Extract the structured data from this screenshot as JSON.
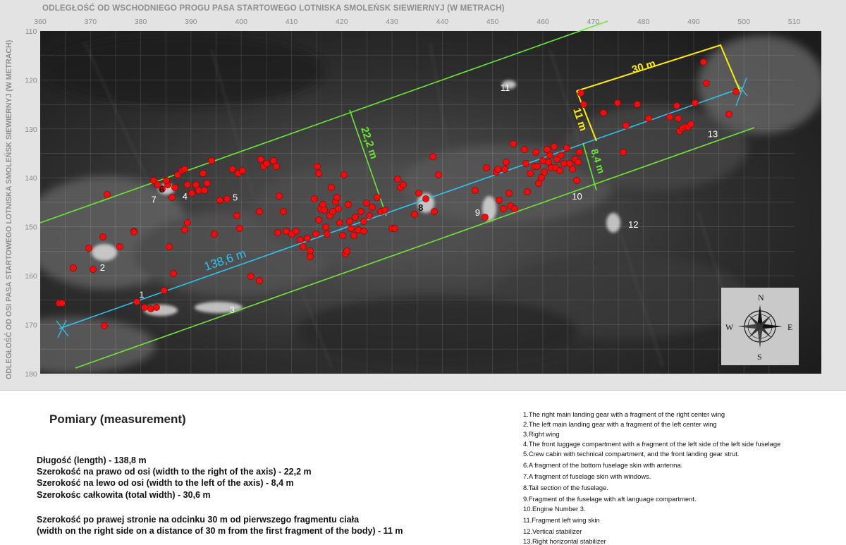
{
  "top_axis_title": "ODLEGŁOŚĆ OD WSCHODNIEGO PROGU PASA STARTOWEGO LOTNISKA SMOLEŃSK SIEWIERNYJ (W METRACH)",
  "left_axis_title": "ODLEGŁOŚĆ OD OSI PASA STARTOWEGO LOTNISKA SMOLEŃSK SIEWIERNYJ (W METRACH)",
  "x_ticks": [
    "360",
    "370",
    "380",
    "390",
    "400",
    "410",
    "420",
    "430",
    "440",
    "450",
    "460",
    "470",
    "480",
    "490",
    "500",
    "510"
  ],
  "y_ticks": [
    "110",
    "120",
    "130",
    "140",
    "150",
    "160",
    "170",
    "180"
  ],
  "x_range": [
    360,
    510
  ],
  "y_range": [
    110,
    180
  ],
  "dimension_labels": {
    "length": "138,6 m",
    "right_width": "22,2 m",
    "left_width": "8,4 m",
    "partial_width": "11 m",
    "section_length": "30 m"
  },
  "compass": {
    "n": "N",
    "s": "S",
    "e": "E",
    "w": "W"
  },
  "marker_labels": [
    {
      "text": "1",
      "x": 380.2,
      "y": 163.8
    },
    {
      "text": "2",
      "x": 372.4,
      "y": 158.3
    },
    {
      "text": "3",
      "x": 398.2,
      "y": 166.9
    },
    {
      "text": "4",
      "x": 388.8,
      "y": 143.7
    },
    {
      "text": "5",
      "x": 398.8,
      "y": 143.9
    },
    {
      "text": "6",
      "x": 384.2,
      "y": 142.3
    },
    {
      "text": "7",
      "x": 382.6,
      "y": 144.4
    },
    {
      "text": "8",
      "x": 435.7,
      "y": 146.0
    },
    {
      "text": "9",
      "x": 447.0,
      "y": 147.0
    },
    {
      "text": "10",
      "x": 466.8,
      "y": 143.7
    },
    {
      "text": "11",
      "x": 452.5,
      "y": 121.5
    },
    {
      "text": "12",
      "x": 478.0,
      "y": 149.5
    },
    {
      "text": "13",
      "x": 493.8,
      "y": 131.0
    }
  ],
  "colors": {
    "axis_line": "#2ec4f0",
    "right_boundary": "#67e832",
    "left_boundary": "#6fe635",
    "yellow": "#ffee00",
    "fragment": "#f20d0d",
    "background_photo": "#2a2a2a"
  },
  "measurements": {
    "title": "Pomiary (measurement)",
    "lines": [
      "Długość (length) - 138,8 m",
      "Szerokość na prawo od osi (width to the right of the axis) - 22,2 m",
      "Szerokość na lewo od osi (width to the left of the axis) - 8,4 m",
      "Szerokośc całkowita (total width) - 30,6 m"
    ],
    "extra_lines": [
      "Szerokość po prawej stronie na odcinku 30 m od pierwszego fragmentu ciała",
      "(width on the right side on a distance of 30 m from the first fragment of the body) - 11 m"
    ]
  },
  "legend": [
    "1.The right main landing gear with a fragment of the right center wing",
    "2.The left main landing gear with a fragment of the left center wing",
    "3.Right wing",
    "4.The front luggage compartment with a fragment of the left side of the left side fuselage",
    "5.Crew cabin with technical compartment, and the front landing gear strut.",
    "6.A fragment of the bottom fuselage skin with antenna.",
    "7.A fragment of fuselage skin with windows.",
    "8.Tail section of the fuselage.",
    "9.Fragment of the fuselage with aft language compartment.",
    "10.Engine Number 3.",
    "11.Fragment left wing skin",
    "12.Vertical stabilizer",
    "13.Right horizontal stabilizer"
  ]
}
